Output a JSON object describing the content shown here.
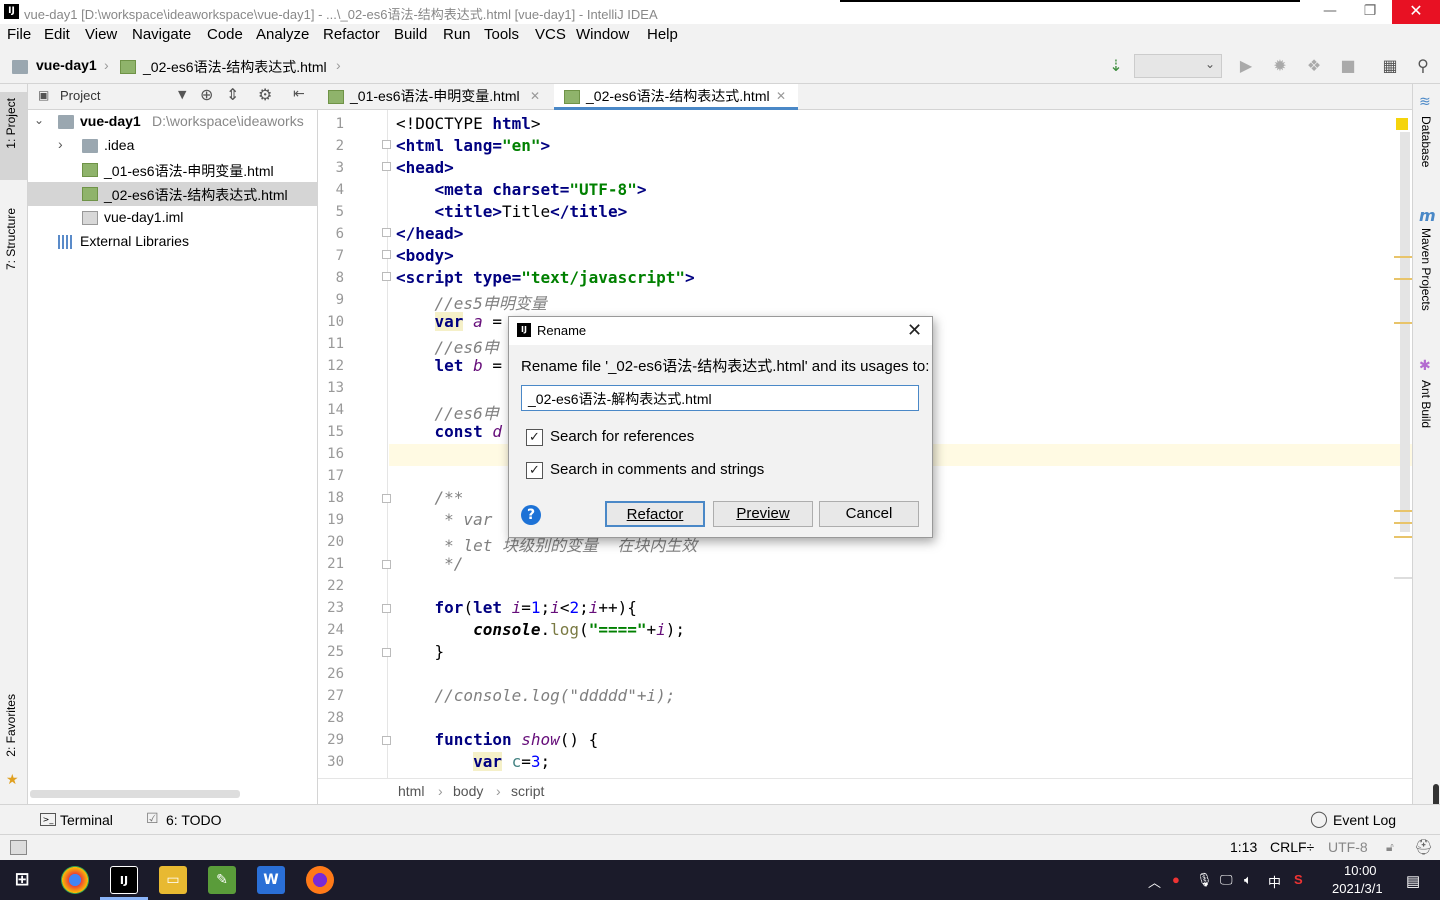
{
  "window": {
    "title": "vue-day1 [D:\\workspace\\ideaworkspace\\vue-day1] - ...\\_02-es6语法-结构表达式.html [vue-day1] - IntelliJ IDEA",
    "app_icon": "IJ",
    "minimize": "—",
    "restore": "❐",
    "close": "✕"
  },
  "menu": [
    "File",
    "Edit",
    "View",
    "Navigate",
    "Code",
    "Analyze",
    "Refactor",
    "Build",
    "Run",
    "Tools",
    "VCS",
    "Window",
    "Help"
  ],
  "navbar": {
    "project": "vue-day1",
    "file": "_02-es6语法-结构表达式.html"
  },
  "left_tabs": {
    "project": "1: Project",
    "structure": "7: Structure",
    "favorites": "2: Favorites"
  },
  "project_panel": {
    "header": "Project",
    "tree": [
      {
        "label": "vue-day1",
        "path": "D:\\workspace\\ideaworks",
        "type": "folder"
      },
      {
        "label": ".idea",
        "type": "folder"
      },
      {
        "label": "_01-es6语法-申明变量.html",
        "type": "html"
      },
      {
        "label": "_02-es6语法-结构表达式.html",
        "type": "html"
      },
      {
        "label": "vue-day1.iml",
        "type": "iml"
      },
      {
        "label": "External Libraries",
        "type": "lib"
      }
    ]
  },
  "tabs": [
    {
      "label": "_01-es6语法-申明变量.html",
      "active": false
    },
    {
      "label": "_02-es6语法-结构表达式.html",
      "active": true
    }
  ],
  "right_tabs": [
    "Database",
    "Maven Projects",
    "Ant Build"
  ],
  "editor": {
    "current_line": 16,
    "line_numbers": [
      "1",
      "2",
      "3",
      "4",
      "5",
      "6",
      "7",
      "8",
      "9",
      "10",
      "11",
      "12",
      "13",
      "14",
      "15",
      "16",
      "17",
      "18",
      "19",
      "20",
      "21",
      "22",
      "23",
      "24",
      "25",
      "26",
      "27",
      "28",
      "29",
      "30"
    ]
  },
  "breadcrumbs": [
    "html",
    "body",
    "script"
  ],
  "bottom_tools": {
    "terminal": "Terminal",
    "todo": "6: TODO",
    "event_log": "Event Log"
  },
  "status": {
    "position": "1:13",
    "line_sep": "CRLF÷",
    "encoding": "UTF-8"
  },
  "taskbar": {
    "time": "10:00",
    "date": "2021/3/1",
    "ime": "中"
  },
  "dialog": {
    "title": "Rename",
    "message": "Rename file '_02-es6语法-结构表达式.html' and its usages to:",
    "input_value": "_02-es6语法-解构表达式.html",
    "options": [
      {
        "label": "Search for references",
        "checked": true
      },
      {
        "label": "Search in comments and strings",
        "checked": true
      }
    ],
    "buttons": {
      "refactor": "Refactor",
      "preview": "Preview",
      "cancel": "Cancel"
    },
    "help": "?",
    "close": "✕"
  },
  "colors": {
    "accent": "#4a88c7",
    "close_red": "#e81123",
    "current_line": "#fffae3"
  }
}
